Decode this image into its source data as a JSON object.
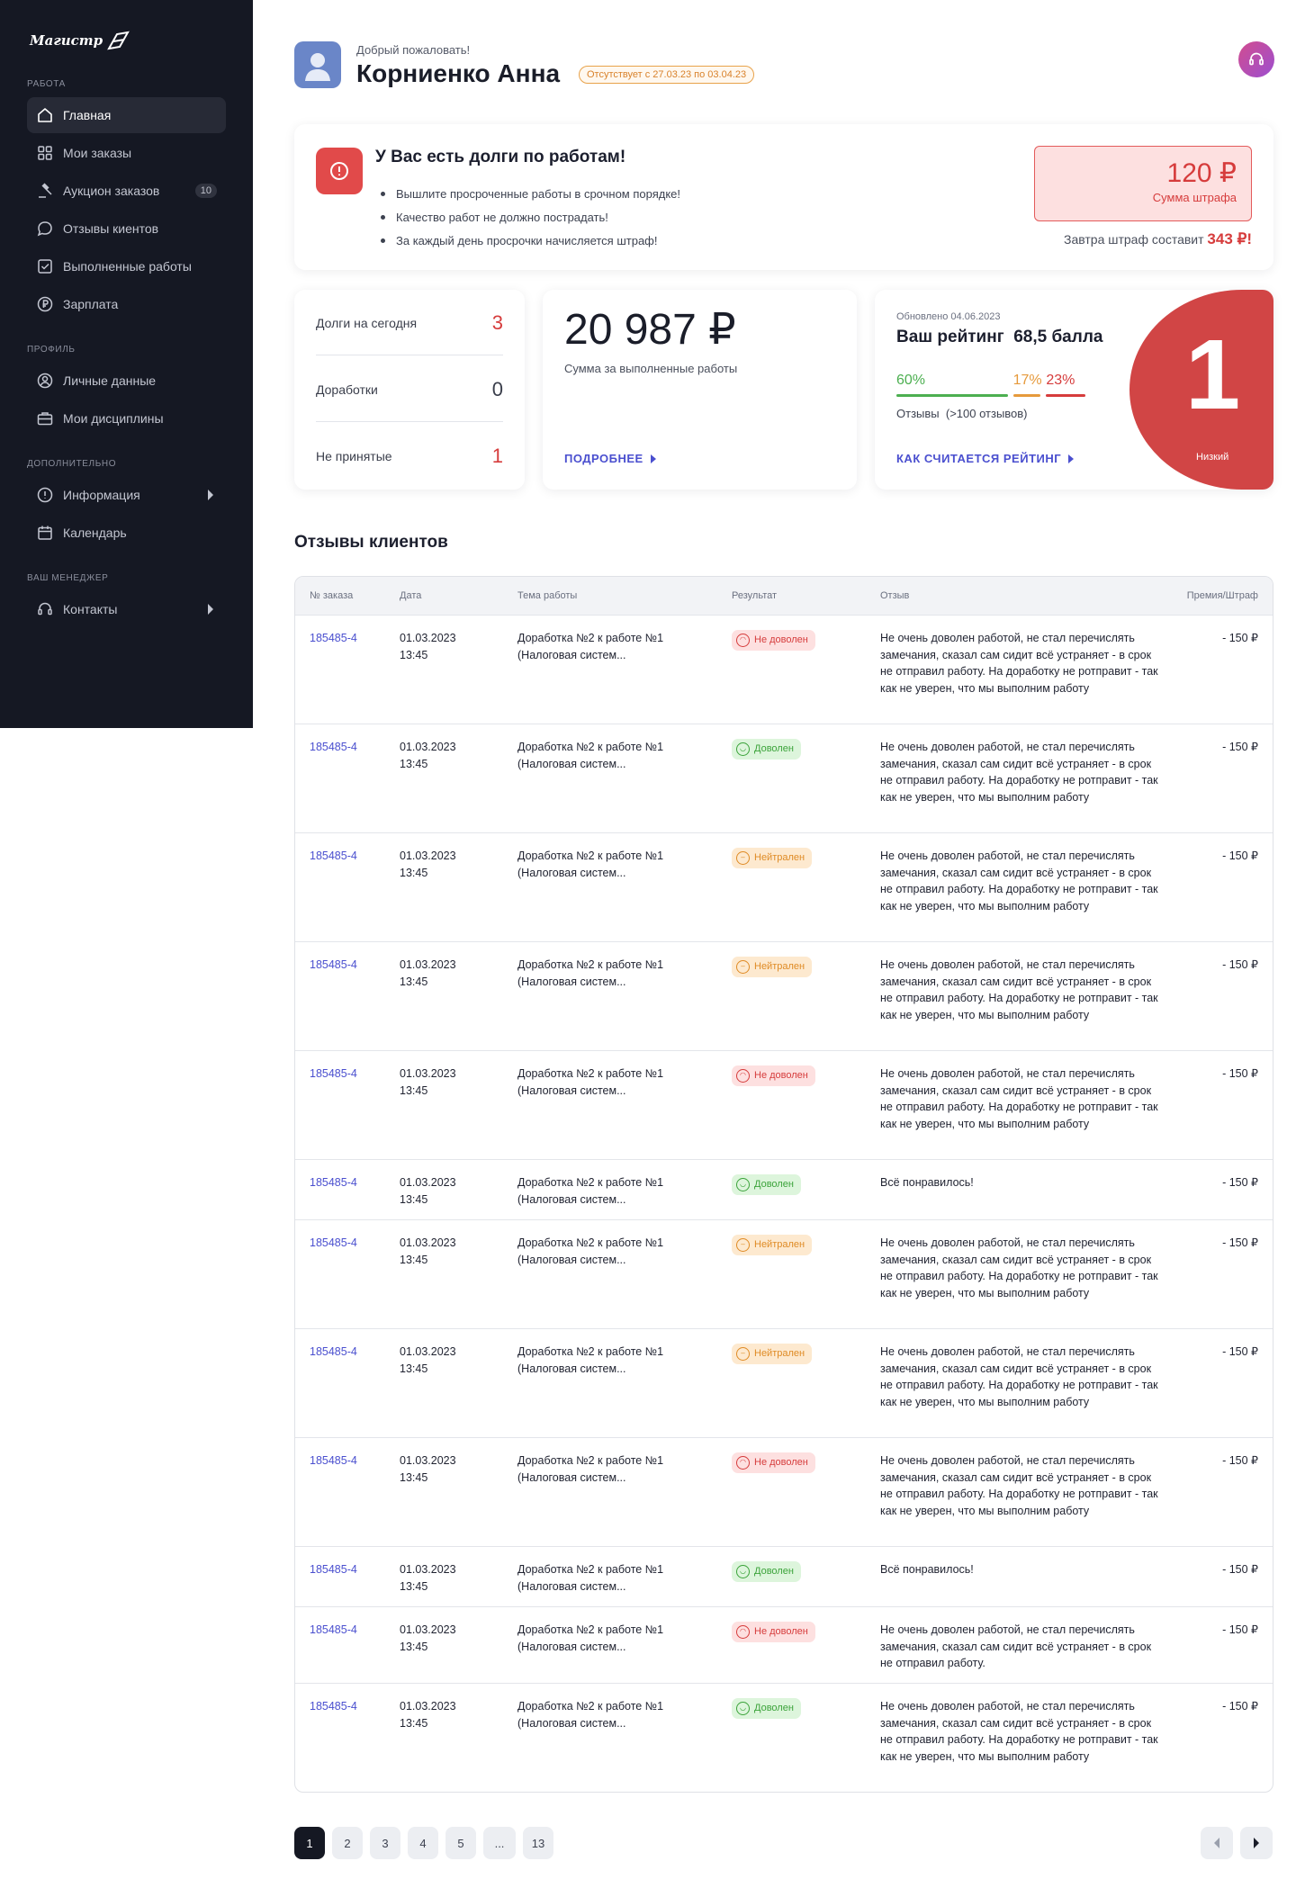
{
  "sidebar": {
    "logo": "Магистр",
    "sections": {
      "work": "Работа",
      "profile": "Профиль",
      "extra": "Дополнительно",
      "manager": "Ваш менеджер"
    },
    "items": [
      {
        "label": "Главная",
        "icon": "home-icon"
      },
      {
        "label": "Мои заказы",
        "icon": "grid-icon"
      },
      {
        "label": "Аукцион заказов",
        "icon": "gavel-icon",
        "badge": "10"
      },
      {
        "label": "Отзывы киентов",
        "icon": "chat-icon"
      },
      {
        "label": "Выполненные работы",
        "icon": "check-square-icon"
      },
      {
        "label": "Зарплата",
        "icon": "ruble-icon"
      },
      {
        "label": "Личные данные",
        "icon": "user-circle-icon"
      },
      {
        "label": "Мои дисциплины",
        "icon": "briefcase-icon"
      },
      {
        "label": "Информация",
        "icon": "info-icon"
      },
      {
        "label": "Календарь",
        "icon": "calendar-icon"
      },
      {
        "label": "Контакты",
        "icon": "headset-icon"
      }
    ]
  },
  "header": {
    "greeting": "Добрый пожаловать!",
    "user_name": "Корниенко Анна",
    "absence": "Отсутствует с 27.03.23 по 03.04.23"
  },
  "debt": {
    "title": "У Вас есть долги по работам!",
    "points": [
      "Вышлите просроченные работы в срочном порядке!",
      "Качество работ не должно пострадать!",
      "За каждый день просрочки начисляется штраф!"
    ],
    "fine_amount": "120 ₽",
    "fine_label": "Сумма штрафа",
    "tomorrow_text": "Завтра штраф составит",
    "tomorrow_amount": "343 ₽!"
  },
  "stats": {
    "debts_today_label": "Долги на сегодня",
    "debts_today": "3",
    "revisions_label": "Доработки",
    "revisions": "0",
    "rejected_label": "Не принятые",
    "rejected": "1"
  },
  "earnings": {
    "amount": "20 987 ₽",
    "label": "Сумма за выполненные работы",
    "more": "ПОДРОБНЕЕ"
  },
  "rating": {
    "updated": "Обновлено 04.06.2023",
    "title": "Ваш рейтинг  68,5 балла",
    "good_pct": "60%",
    "neutral_pct": "17%",
    "bad_pct": "23%",
    "good_value": 60,
    "neutral_value": 17,
    "bad_value": 23,
    "reviews_label": "Отзывы",
    "reviews_count": "(>100 отзывов)",
    "how": "КАК СЧИТАЕТСЯ РЕЙТИНГ",
    "rank": "1",
    "rank_label": "Низкий",
    "colors": {
      "good": "#4caf50",
      "neutral": "#e69a3c",
      "bad": "#d63c3c"
    }
  },
  "reviews": {
    "title": "Отзывы клиентов",
    "columns": [
      "№ заказа",
      "Дата",
      "Тема работы",
      "Результат",
      "Отзыв",
      "Премия/Штраф"
    ],
    "rows": [
      {
        "order": "185485-4",
        "date": "01.03.2023",
        "time": "13:45",
        "topic1": "Доработка №2 к работе №1",
        "topic2": "(Налоговая систем...",
        "result": "Не доволен",
        "kind": "bad",
        "review": "Не очень доволен работой, не стал перечислять замечания, сказал сам сидит всё устраняет - в срок не отправил работу. На доработку не ротправит - так как не уверен, что мы выполним работу",
        "amount": "- 150 ₽"
      },
      {
        "order": "185485-4",
        "date": "01.03.2023",
        "time": "13:45",
        "topic1": "Доработка №2 к работе №1",
        "topic2": "(Налоговая систем...",
        "result": "Доволен",
        "kind": "good",
        "review": "Не очень доволен работой, не стал перечислять замечания, сказал сам сидит всё устраняет - в срок не отправил работу. На доработку не ротправит - так как не уверен, что мы выполним работу",
        "amount": "- 150 ₽"
      },
      {
        "order": "185485-4",
        "date": "01.03.2023",
        "time": "13:45",
        "topic1": "Доработка №2 к работе №1",
        "topic2": "(Налоговая систем...",
        "result": "Нейтрален",
        "kind": "neu",
        "review": "Не очень доволен работой, не стал перечислять замечания, сказал сам сидит всё устраняет - в срок не отправил работу. На доработку не ротправит - так как не уверен, что мы выполним работу",
        "amount": "- 150 ₽"
      },
      {
        "order": "185485-4",
        "date": "01.03.2023",
        "time": "13:45",
        "topic1": "Доработка №2 к работе №1",
        "topic2": "(Налоговая систем...",
        "result": "Нейтрален",
        "kind": "neu",
        "review": "Не очень доволен работой, не стал перечислять замечания, сказал сам сидит всё устраняет - в срок не отправил работу. На доработку не ротправит - так как не уверен, что мы выполним работу",
        "amount": "- 150 ₽"
      },
      {
        "order": "185485-4",
        "date": "01.03.2023",
        "time": "13:45",
        "topic1": "Доработка №2 к работе №1",
        "topic2": "(Налоговая систем...",
        "result": "Не доволен",
        "kind": "bad",
        "review": "Не очень доволен работой, не стал перечислять замечания, сказал сам сидит всё устраняет - в срок не отправил работу. На доработку не ротправит - так как не уверен, что мы выполним работу",
        "amount": "- 150 ₽"
      },
      {
        "order": "185485-4",
        "date": "01.03.2023",
        "time": "13:45",
        "topic1": "Доработка №2 к работе №1",
        "topic2": "(Налоговая систем...",
        "result": "Доволен",
        "kind": "good",
        "review": "Всё понравилось!",
        "amount": "- 150 ₽"
      },
      {
        "order": "185485-4",
        "date": "01.03.2023",
        "time": "13:45",
        "topic1": "Доработка №2 к работе №1",
        "topic2": "(Налоговая систем...",
        "result": "Нейтрален",
        "kind": "neu",
        "review": "Не очень доволен работой, не стал перечислять замечания, сказал сам сидит всё устраняет - в срок не отправил работу. На доработку не ротправит - так как не уверен, что мы выполним работу",
        "amount": "- 150 ₽"
      },
      {
        "order": "185485-4",
        "date": "01.03.2023",
        "time": "13:45",
        "topic1": "Доработка №2 к работе №1",
        "topic2": "(Налоговая систем...",
        "result": "Нейтрален",
        "kind": "neu",
        "review": "Не очень доволен работой, не стал перечислять замечания, сказал сам сидит всё устраняет - в срок не отправил работу. На доработку не ротправит - так как не уверен, что мы выполним работу",
        "amount": "- 150 ₽"
      },
      {
        "order": "185485-4",
        "date": "01.03.2023",
        "time": "13:45",
        "topic1": "Доработка №2 к работе №1",
        "topic2": "(Налоговая систем...",
        "result": "Не доволен",
        "kind": "bad",
        "review": "Не очень доволен работой, не стал перечислять замечания, сказал сам сидит всё устраняет - в срок не отправил работу. На доработку не ротправит - так как не уверен, что мы выполним работу",
        "amount": "- 150 ₽"
      },
      {
        "order": "185485-4",
        "date": "01.03.2023",
        "time": "13:45",
        "topic1": "Доработка №2 к работе №1",
        "topic2": "(Налоговая систем...",
        "result": "Доволен",
        "kind": "good",
        "review": "Всё понравилось!",
        "amount": "- 150 ₽"
      },
      {
        "order": "185485-4",
        "date": "01.03.2023",
        "time": "13:45",
        "topic1": "Доработка №2 к работе №1",
        "topic2": "(Налоговая систем...",
        "result": "Не доволен",
        "kind": "bad",
        "review": "Не очень доволен работой, не стал перечислять замечания, сказал сам сидит всё устраняет - в срок не отправил работу.",
        "amount": "- 150 ₽"
      },
      {
        "order": "185485-4",
        "date": "01.03.2023",
        "time": "13:45",
        "topic1": "Доработка №2 к работе №1",
        "topic2": "(Налоговая систем...",
        "result": "Доволен",
        "kind": "good",
        "review": "Не очень доволен работой, не стал перечислять замечания, сказал сам сидит всё устраняет - в срок не отправил работу. На доработку не ротправит - так как не уверен, что мы выполним работу",
        "amount": "- 150 ₽"
      }
    ]
  },
  "pagination": {
    "pages": [
      "1",
      "2",
      "3",
      "4",
      "5",
      "...",
      "13"
    ],
    "current": "1"
  }
}
